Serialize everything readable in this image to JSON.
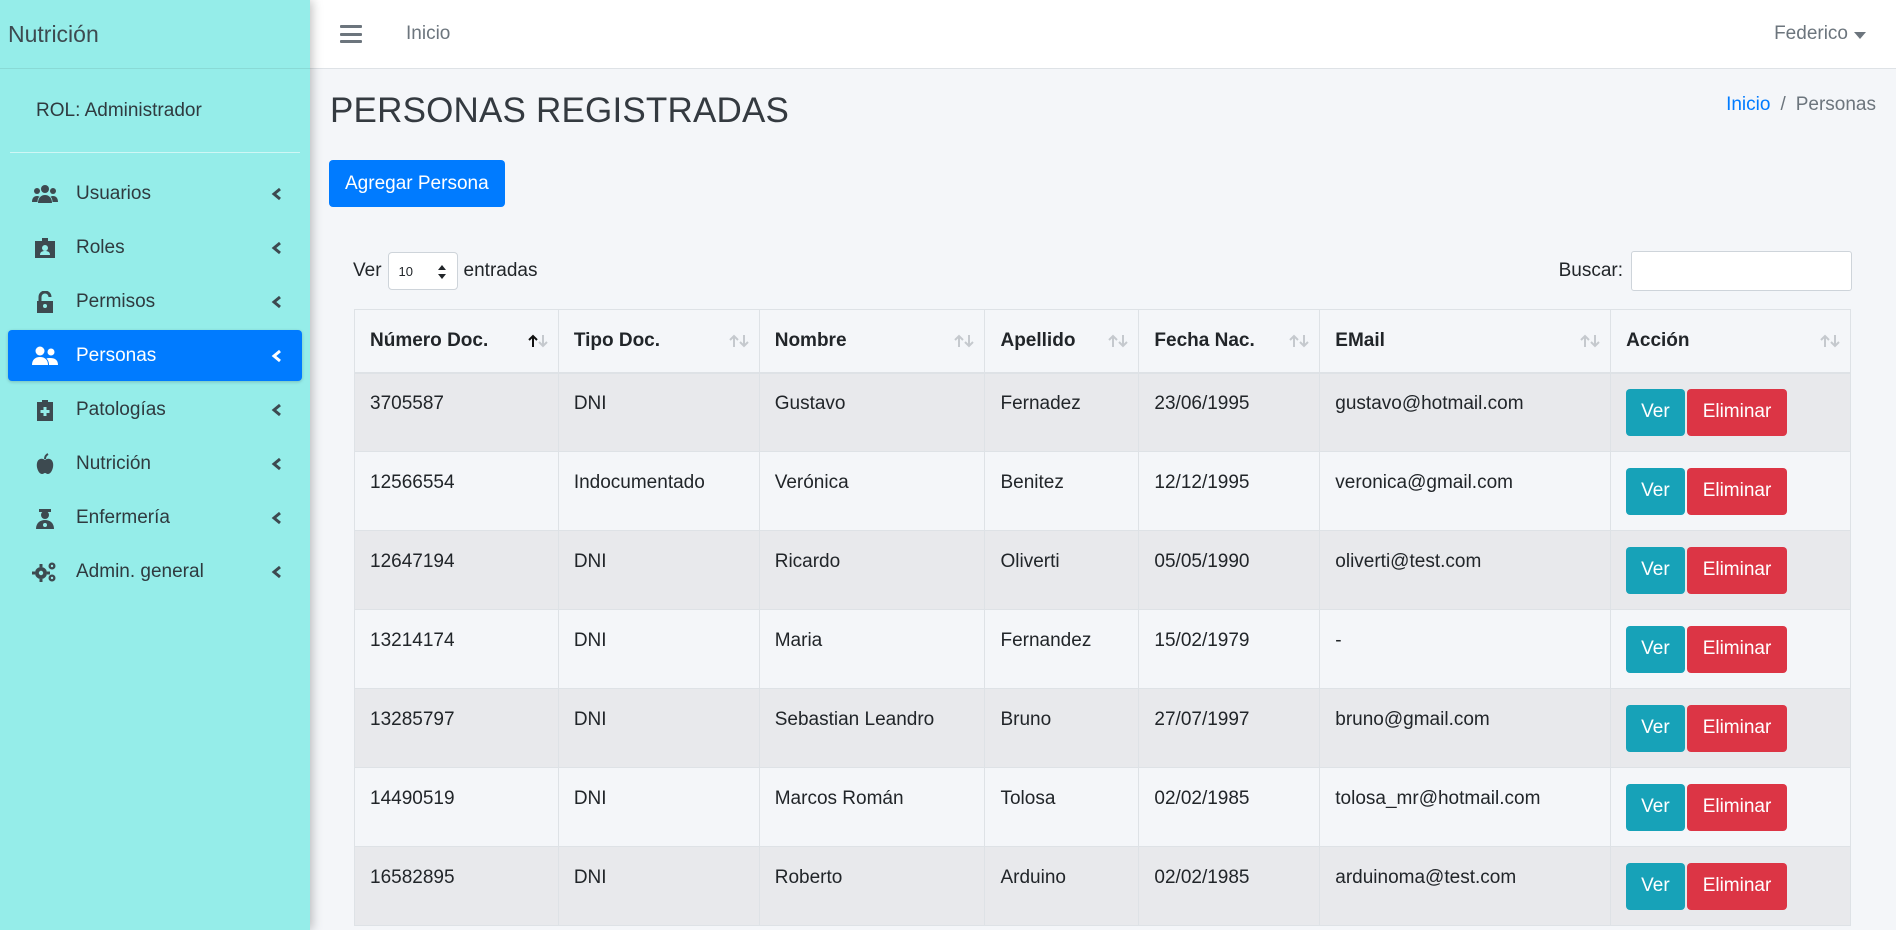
{
  "app": {
    "brand": "Nutrición",
    "role_label": "ROL: Administrador"
  },
  "sidebar": {
    "items": [
      {
        "label": "Usuarios",
        "icon": "users-icon",
        "active": false
      },
      {
        "label": "Roles",
        "icon": "id-badge-icon",
        "active": false
      },
      {
        "label": "Permisos",
        "icon": "unlock-icon",
        "active": false
      },
      {
        "label": "Personas",
        "icon": "user-friends-icon",
        "active": true
      },
      {
        "label": "Patologías",
        "icon": "clipboard-medical-icon",
        "active": false
      },
      {
        "label": "Nutrición",
        "icon": "apple-icon",
        "active": false
      },
      {
        "label": "Enfermería",
        "icon": "user-nurse-icon",
        "active": false
      },
      {
        "label": "Admin. general",
        "icon": "cogs-icon",
        "active": false
      }
    ]
  },
  "topbar": {
    "home_link": "Inicio",
    "user_name": "Federico"
  },
  "page": {
    "title": "PERSONAS REGISTRADAS",
    "breadcrumb": {
      "home": "Inicio",
      "separator": "/",
      "current": "Personas"
    },
    "add_button": "Agregar Persona"
  },
  "table_controls": {
    "show_label": "Ver",
    "page_length": "10",
    "entries_label": "entradas",
    "search_label": "Buscar:",
    "search_value": ""
  },
  "table": {
    "columns": [
      "Número Doc.",
      "Tipo Doc.",
      "Nombre",
      "Apellido",
      "Fecha Nac.",
      "EMail",
      "Acción"
    ],
    "rows": [
      {
        "doc": "3705587",
        "tipo": "DNI",
        "nombre": "Gustavo",
        "apellido": "Fernadez",
        "fecha": "23/06/1995",
        "email": "gustavo@hotmail.com"
      },
      {
        "doc": "12566554",
        "tipo": "Indocumentado",
        "nombre": "Verónica",
        "apellido": "Benitez",
        "fecha": "12/12/1995",
        "email": "veronica@gmail.com"
      },
      {
        "doc": "12647194",
        "tipo": "DNI",
        "nombre": "Ricardo",
        "apellido": "Oliverti",
        "fecha": "05/05/1990",
        "email": "oliverti@test.com"
      },
      {
        "doc": "13214174",
        "tipo": "DNI",
        "nombre": "Maria",
        "apellido": "Fernandez",
        "fecha": "15/02/1979",
        "email": "-"
      },
      {
        "doc": "13285797",
        "tipo": "DNI",
        "nombre": "Sebastian Leandro",
        "apellido": "Bruno",
        "fecha": "27/07/1997",
        "email": "bruno@gmail.com"
      },
      {
        "doc": "14490519",
        "tipo": "DNI",
        "nombre": "Marcos Román",
        "apellido": "Tolosa",
        "fecha": "02/02/1985",
        "email": "tolosa_mr@hotmail.com"
      },
      {
        "doc": "16582895",
        "tipo": "DNI",
        "nombre": "Roberto",
        "apellido": "Arduino",
        "fecha": "02/02/1985",
        "email": "arduinoma@test.com"
      }
    ],
    "action_view": "Ver",
    "action_delete": "Eliminar"
  },
  "colors": {
    "sidebar_bg": "#95ede9",
    "primary": "#007bff",
    "info": "#17a2b8",
    "danger": "#dc3545",
    "content_bg": "#f4f6f9"
  }
}
